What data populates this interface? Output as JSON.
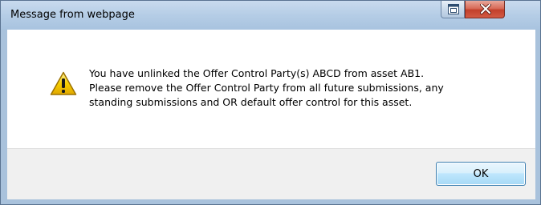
{
  "window": {
    "title": "Message from webpage"
  },
  "controls": {
    "restore_icon": "restore-icon",
    "close_icon": "close-icon"
  },
  "dialog": {
    "icon": "warning-icon",
    "message_lines": [
      "You have unlinked the Offer Control Party(s) ABCD from asset AB1.",
      "Please remove the Offer Control Party from all future submissions, any",
      "standing submissions and OR default offer control for this asset."
    ]
  },
  "buttons": {
    "ok_label": "OK"
  },
  "colors": {
    "frame": "#a9c2dc",
    "close_button": "#c7432e",
    "warning_yellow": "#f5c400",
    "ok_button_border": "#3c7fb1"
  }
}
